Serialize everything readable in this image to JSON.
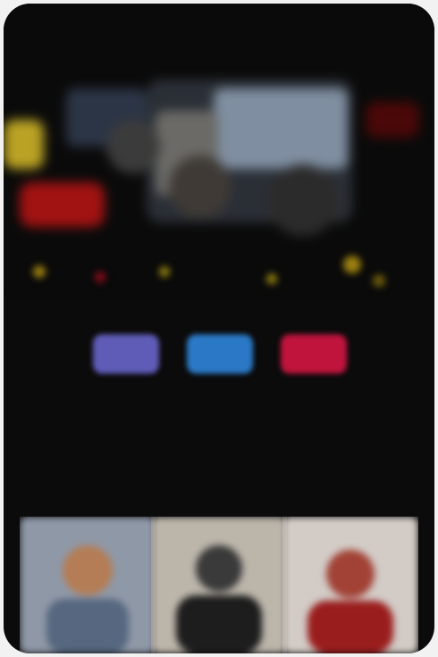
{
  "app": {
    "title": ""
  },
  "hero": {
    "title": ""
  },
  "actions": {
    "buttons": [
      {
        "label": ""
      },
      {
        "label": ""
      },
      {
        "label": ""
      }
    ]
  },
  "description": {
    "lines": [
      "",
      "",
      ""
    ]
  },
  "colors": {
    "background": "#0b0b0b",
    "button_1": "#5f5cb8",
    "button_2": "#2b79c6",
    "button_3": "#c0143d"
  },
  "tiles": [
    {
      "name": "person-blue-tile"
    },
    {
      "name": "person-dark-tile"
    },
    {
      "name": "person-red-tile"
    }
  ]
}
